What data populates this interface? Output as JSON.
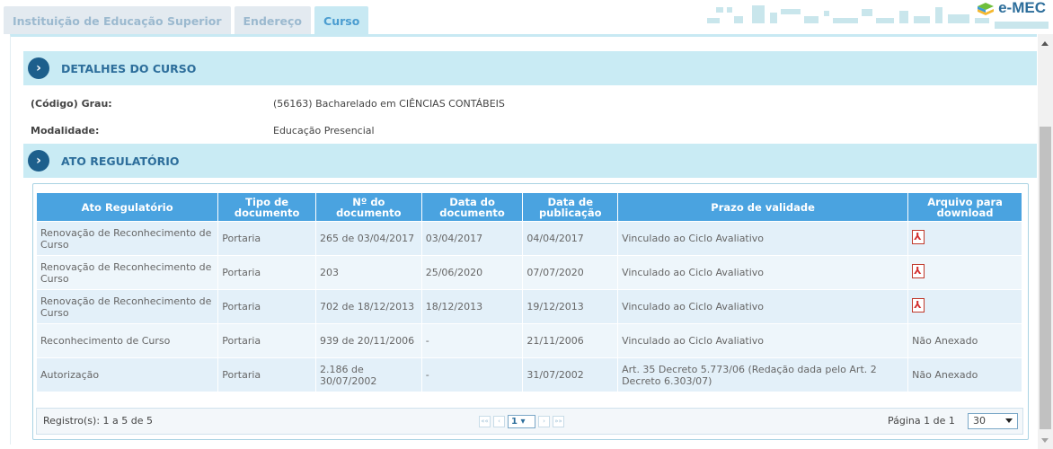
{
  "tabs": [
    {
      "label": "Instituição de Educação Superior",
      "active": false
    },
    {
      "label": "Endereço",
      "active": false
    },
    {
      "label": "Curso",
      "active": true
    }
  ],
  "logo": {
    "text": "e-MEC",
    "icon": "book-icon"
  },
  "sections": {
    "course": {
      "title": "DETALHES DO CURSO",
      "icon": "chevron-right-icon"
    },
    "regulatory": {
      "title": "ATO REGULATÓRIO",
      "icon": "chevron-right-icon"
    }
  },
  "details": [
    {
      "label": "(Código) Grau:",
      "value": "(56163) Bacharelado em CIÊNCIAS CONTÁBEIS"
    },
    {
      "label": "Modalidade:",
      "value": "Educação Presencial"
    }
  ],
  "table": {
    "headers": [
      "Ato Regulatório",
      "Tipo de documento",
      "Nº do documento",
      "Data do documento",
      "Data de publicação",
      "Prazo de validade",
      "Arquivo para download"
    ],
    "rows": [
      {
        "ato": "Renovação de Reconhecimento de Curso",
        "tipo": "Portaria",
        "numero": "265 de 03/04/2017",
        "data_doc": "03/04/2017",
        "data_pub": "04/04/2017",
        "prazo": "Vinculado ao Ciclo Avaliativo",
        "arquivo": "pdf-icon"
      },
      {
        "ato": "Renovação de Reconhecimento de Curso",
        "tipo": "Portaria",
        "numero": "203",
        "data_doc": "25/06/2020",
        "data_pub": "07/07/2020",
        "prazo": "Vinculado ao Ciclo Avaliativo",
        "arquivo": "pdf-icon"
      },
      {
        "ato": "Renovação de Reconhecimento de Curso",
        "tipo": "Portaria",
        "numero": "702 de 18/12/2013",
        "data_doc": "18/12/2013",
        "data_pub": "19/12/2013",
        "prazo": "Vinculado ao Ciclo Avaliativo",
        "arquivo": "pdf-icon"
      },
      {
        "ato": "Reconhecimento de Curso",
        "tipo": "Portaria",
        "numero": "939 de 20/11/2006",
        "data_doc": "-",
        "data_pub": "21/11/2006",
        "prazo": "Vinculado ao Ciclo Avaliativo",
        "arquivo": "Não Anexado"
      },
      {
        "ato": "Autorização",
        "tipo": "Portaria",
        "numero": "2.186 de 30/07/2002",
        "data_doc": "-",
        "data_pub": "31/07/2002",
        "prazo": "Art. 35 Decreto 5.773/06 (Redação dada pelo Art. 2 Decreto 6.303/07)",
        "arquivo": "Não Anexado"
      }
    ]
  },
  "footer": {
    "registros": "Registro(s): 1 a 5 de 5",
    "pager": {
      "first": "««",
      "prev": "‹",
      "current_page": "1",
      "next": "›",
      "last": "»»"
    },
    "page_info": "Página 1 de 1",
    "per_page": "30"
  }
}
